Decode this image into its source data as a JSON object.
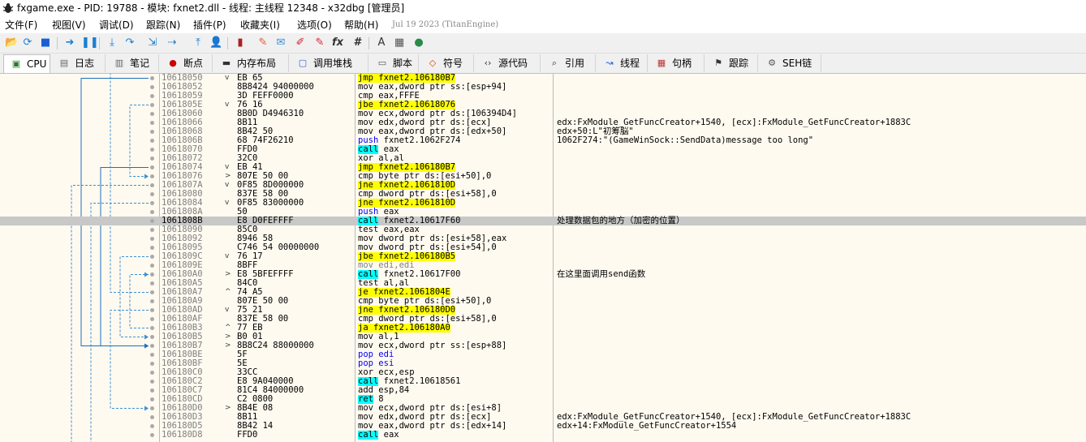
{
  "window": {
    "title": "fxgame.exe - PID: 19788 - 模块: fxnet2.dll - 线程: 主线程 12348 - x32dbg [管理员]"
  },
  "menu": {
    "items": [
      "文件(F)",
      "视图(V)",
      "调试(D)",
      "跟踪(N)",
      "插件(P)",
      "收藏夹(I)",
      "选项(O)",
      "帮助(H)"
    ],
    "build_date": "Jul 19 2023 (TitanEngine)"
  },
  "toolbar": {
    "icons": [
      "open-icon",
      "restart-icon",
      "stop-icon",
      "run-icon",
      "pause-icon",
      "step-into-icon",
      "step-over-icon",
      "trace-into-icon",
      "trace-over-icon",
      "execute-till-return-icon",
      "run-to-user-code-icon",
      "scylla-icon",
      "patch-icon",
      "comment-icon",
      "label-icon",
      "bookmark-icon",
      "function-icon",
      "hash-icon",
      "font-icon",
      "calculator-icon",
      "globe-icon"
    ],
    "fx_label": "fx",
    "hash_label": "#"
  },
  "tabs": [
    {
      "label": "CPU",
      "icon": "cpu-icon"
    },
    {
      "label": "日志",
      "icon": "log-icon"
    },
    {
      "label": "笔记",
      "icon": "notes-icon"
    },
    {
      "label": "断点",
      "icon": "breakpoint-icon"
    },
    {
      "label": "内存布局",
      "icon": "memory-icon"
    },
    {
      "label": "调用堆栈",
      "icon": "callstack-icon"
    },
    {
      "label": "脚本",
      "icon": "script-icon"
    },
    {
      "label": "符号",
      "icon": "symbol-icon"
    },
    {
      "label": "源代码",
      "icon": "source-icon"
    },
    {
      "label": "引用",
      "icon": "reference-icon"
    },
    {
      "label": "线程",
      "icon": "thread-icon"
    },
    {
      "label": "句柄",
      "icon": "handle-icon"
    },
    {
      "label": "跟踪",
      "icon": "trace-icon"
    },
    {
      "label": "SEH链",
      "icon": "seh-icon"
    }
  ],
  "active_tab": "CPU",
  "colors": {
    "jump_highlight": "#ffff00",
    "call_highlight": "#00ffff",
    "selected_row": "#c8c8c8",
    "background": "#fffaf0"
  },
  "disasm": [
    {
      "addr": "10618050",
      "arrow": "v",
      "bytes": "EB 65",
      "mn": "jmp",
      "op": "fxnet2.106180B7",
      "type": "jmp",
      "cmt": ""
    },
    {
      "addr": "10618052",
      "arrow": "",
      "bytes": "8B8424 94000000",
      "mn": "mov",
      "op": "eax,dword ptr ss:[esp+94]",
      "type": "",
      "cmt": ""
    },
    {
      "addr": "10618059",
      "arrow": "",
      "bytes": "3D FEFF0000",
      "mn": "cmp",
      "op": "eax,FFFE",
      "type": "",
      "cmt": ""
    },
    {
      "addr": "1061805E",
      "arrow": "v",
      "bytes": "76 16",
      "mn": "jbe",
      "op": "fxnet2.10618076",
      "type": "jmp",
      "cmt": ""
    },
    {
      "addr": "10618060",
      "arrow": "",
      "bytes": "8B0D D4946310",
      "mn": "mov",
      "op": "ecx,dword ptr ds:[106394D4]",
      "type": "",
      "cmt": ""
    },
    {
      "addr": "10618066",
      "arrow": "",
      "bytes": "8B11",
      "mn": "mov",
      "op": "edx,dword ptr ds:[ecx]",
      "type": "",
      "cmt": "edx:FxModule_GetFuncCreator+1540, [ecx]:FxModule_GetFuncCreator+1883C"
    },
    {
      "addr": "10618068",
      "arrow": "",
      "bytes": "8B42 50",
      "mn": "mov",
      "op": "eax,dword ptr ds:[edx+50]",
      "type": "",
      "cmt": "edx+50:L\"初筹脳\""
    },
    {
      "addr": "1061806B",
      "arrow": "",
      "bytes": "68 74F26210",
      "mn": "push",
      "op": "fxnet2.1062F274",
      "type": "push",
      "cmt": "1062F274:\"(GameWinSock::SendData)message too long\""
    },
    {
      "addr": "10618070",
      "arrow": "",
      "bytes": "FFD0",
      "mn": "call",
      "op": "eax",
      "type": "call",
      "cmt": ""
    },
    {
      "addr": "10618072",
      "arrow": "",
      "bytes": "32C0",
      "mn": "xor",
      "op": "al,al",
      "type": "",
      "cmt": ""
    },
    {
      "addr": "10618074",
      "arrow": "v",
      "bytes": "EB 41",
      "mn": "jmp",
      "op": "fxnet2.106180B7",
      "type": "jmp",
      "cmt": ""
    },
    {
      "addr": "10618076",
      "arrow": ">",
      "bytes": "807E 50 00",
      "mn": "cmp",
      "op": "byte ptr ds:[esi+50],0",
      "type": "",
      "cmt": ""
    },
    {
      "addr": "1061807A",
      "arrow": "v",
      "bytes": "0F85 8D000000",
      "mn": "jne",
      "op": "fxnet2.1061810D",
      "type": "jmp",
      "cmt": ""
    },
    {
      "addr": "10618080",
      "arrow": "",
      "bytes": "837E 58 00",
      "mn": "cmp",
      "op": "dword ptr ds:[esi+58],0",
      "type": "",
      "cmt": ""
    },
    {
      "addr": "10618084",
      "arrow": "v",
      "bytes": "0F85 83000000",
      "mn": "jne",
      "op": "fxnet2.1061810D",
      "type": "jmp",
      "cmt": ""
    },
    {
      "addr": "1061808A",
      "arrow": "",
      "bytes": "50",
      "mn": "push",
      "op": "eax",
      "type": "push",
      "cmt": ""
    },
    {
      "addr": "1061808B",
      "arrow": "",
      "bytes": "E8 D0FEFFFF",
      "mn": "call",
      "op": "fxnet2.10617F60",
      "type": "call",
      "cmt": "处理数据包的地方（加密的位置）",
      "sel": true
    },
    {
      "addr": "10618090",
      "arrow": "",
      "bytes": "85C0",
      "mn": "test",
      "op": "eax,eax",
      "type": "",
      "cmt": ""
    },
    {
      "addr": "10618092",
      "arrow": "",
      "bytes": "8946 58",
      "mn": "mov",
      "op": "dword ptr ds:[esi+58],eax",
      "type": "",
      "cmt": ""
    },
    {
      "addr": "10618095",
      "arrow": "",
      "bytes": "C746 54 00000000",
      "mn": "mov",
      "op": "dword ptr ds:[esi+54],0",
      "type": "",
      "cmt": ""
    },
    {
      "addr": "1061809C",
      "arrow": "v",
      "bytes": "76 17",
      "mn": "jbe",
      "op": "fxnet2.106180B5",
      "type": "jmp",
      "cmt": ""
    },
    {
      "addr": "1061809E",
      "arrow": "",
      "bytes": "8BFF",
      "mn": "mov",
      "op": "edi,edi",
      "type": "nop",
      "cmt": ""
    },
    {
      "addr": "106180A0",
      "arrow": ">",
      "bytes": "E8 5BFEFFFF",
      "mn": "call",
      "op": "fxnet2.10617F00",
      "type": "call",
      "cmt": "在这里面调用send函数"
    },
    {
      "addr": "106180A5",
      "arrow": "",
      "bytes": "84C0",
      "mn": "test",
      "op": "al,al",
      "type": "",
      "cmt": ""
    },
    {
      "addr": "106180A7",
      "arrow": "^",
      "bytes": "74 A5",
      "mn": "je",
      "op": "fxnet2.1061804E",
      "type": "jmp",
      "cmt": ""
    },
    {
      "addr": "106180A9",
      "arrow": "",
      "bytes": "807E 50 00",
      "mn": "cmp",
      "op": "byte ptr ds:[esi+50],0",
      "type": "",
      "cmt": ""
    },
    {
      "addr": "106180AD",
      "arrow": "v",
      "bytes": "75 21",
      "mn": "jne",
      "op": "fxnet2.106180D0",
      "type": "jmp",
      "cmt": ""
    },
    {
      "addr": "106180AF",
      "arrow": "",
      "bytes": "837E 58 00",
      "mn": "cmp",
      "op": "dword ptr ds:[esi+58],0",
      "type": "",
      "cmt": ""
    },
    {
      "addr": "106180B3",
      "arrow": "^",
      "bytes": "77 EB",
      "mn": "ja",
      "op": "fxnet2.106180A0",
      "type": "jmp",
      "cmt": ""
    },
    {
      "addr": "106180B5",
      "arrow": ">",
      "bytes": "B0 01",
      "mn": "mov",
      "op": "al,1",
      "type": "",
      "cmt": ""
    },
    {
      "addr": "106180B7",
      "arrow": ">",
      "bytes": "8B8C24 88000000",
      "mn": "mov",
      "op": "ecx,dword ptr ss:[esp+88]",
      "type": "",
      "cmt": ""
    },
    {
      "addr": "106180BE",
      "arrow": "",
      "bytes": "5F",
      "mn": "pop",
      "op": "edi",
      "type": "pop",
      "cmt": ""
    },
    {
      "addr": "106180BF",
      "arrow": "",
      "bytes": "5E",
      "mn": "pop",
      "op": "esi",
      "type": "pop",
      "cmt": ""
    },
    {
      "addr": "106180C0",
      "arrow": "",
      "bytes": "33CC",
      "mn": "xor",
      "op": "ecx,esp",
      "type": "",
      "cmt": ""
    },
    {
      "addr": "106180C2",
      "arrow": "",
      "bytes": "E8 9A040000",
      "mn": "call",
      "op": "fxnet2.10618561",
      "type": "call",
      "cmt": ""
    },
    {
      "addr": "106180C7",
      "arrow": "",
      "bytes": "81C4 84000000",
      "mn": "add",
      "op": "esp,84",
      "type": "",
      "cmt": ""
    },
    {
      "addr": "106180CD",
      "arrow": "",
      "bytes": "C2 0800",
      "mn": "ret",
      "op": "8",
      "type": "ret",
      "cmt": ""
    },
    {
      "addr": "106180D0",
      "arrow": ">",
      "bytes": "8B4E 08",
      "mn": "mov",
      "op": "ecx,dword ptr ds:[esi+8]",
      "type": "",
      "cmt": ""
    },
    {
      "addr": "106180D3",
      "arrow": "",
      "bytes": "8B11",
      "mn": "mov",
      "op": "edx,dword ptr ds:[ecx]",
      "type": "",
      "cmt": "edx:FxModule_GetFuncCreator+1540, [ecx]:FxModule_GetFuncCreator+1883C"
    },
    {
      "addr": "106180D5",
      "arrow": "",
      "bytes": "8B42 14",
      "mn": "mov",
      "op": "eax,dword ptr ds:[edx+14]",
      "type": "",
      "cmt": "edx+14:FxModule_GetFuncCreator+1554"
    },
    {
      "addr": "106180D8",
      "arrow": "",
      "bytes": "FFD0",
      "mn": "call",
      "op": "eax",
      "type": "call",
      "cmt": ""
    }
  ]
}
